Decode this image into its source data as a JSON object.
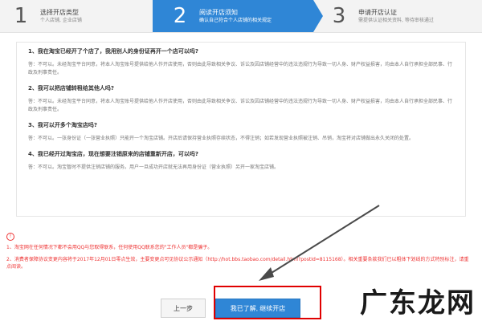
{
  "steps": [
    {
      "num": "1",
      "title": "选择开店类型",
      "subtitle": "个人店铺, 企业店铺"
    },
    {
      "num": "2",
      "title": "阅读开店须知",
      "subtitle": "确认自己符合个人店铺的相关规定"
    },
    {
      "num": "3",
      "title": "申请开店认证",
      "subtitle": "需提供认证相关资料, 等待审核通过"
    }
  ],
  "faqs": [
    {
      "q": "1、我在淘宝已经开了个店了，我用别人的身份证再开一个店可以吗?",
      "a": "答：不可以。未经淘宝平台同意，将本人淘宝账号提供给他人作开店使用，否则由此导致相关争议、诉讼及因店铺经营中的违法违规行为导致一切人身、财产权益损害，均由本人自行承担全部民事、行政及刑事责任。"
    },
    {
      "q": "2、我可以把店铺转租给其他人吗?",
      "a": "答：不可以。未经淘宝平台同意，将本人淘宝账号提供给他人作开店使用，否则由此导致相关争议、诉讼及因店铺经营中的违法违规行为导致一切人身、财产权益损害，均由本人自行承担全部民事、行政及刑事责任。"
    },
    {
      "q": "3、我可以开多个淘宝店吗?",
      "a": "答：不可以。一张身份证（一张营业执照）只能开一个淘宝店铺。开店后请保持营业执照存续状态，不得注销；如若发现营业执照被注销、吊销，淘宝将对店铺做出永久关闭的处置。"
    },
    {
      "q": "4、我已经开过淘宝店，现在想要注销原来的店铺重新开店，可以吗?",
      "a": "答：不可以。淘宝暂时不提供注销店铺的服务。用户一旦成功开店就无法再用身份证（营业执照）另开一家淘宝店铺。"
    }
  ],
  "warning": {
    "icon": "!",
    "line1": "1、淘宝网在任何情况下都不会用QQ与您取得联系，任何使用QQ联系您的\"工作人员\"都是骗子。",
    "line2": "2、消费者保障协议变更内容将于2017年12月01日零点生效，主要变更点可见协议公示通知（http://hot.bbs.taobao.com/detail.html?postId=8115168）。相关重要条款我们已以粗体下划线的方式特别标注，请重点阅读。"
  },
  "buttons": {
    "prev": "上一步",
    "next": "我已了解, 继续开店"
  },
  "watermark": "广东龙网",
  "colors": {
    "accent": "#2f86d6",
    "warning": "#e33333",
    "highlight": "#e00000"
  }
}
